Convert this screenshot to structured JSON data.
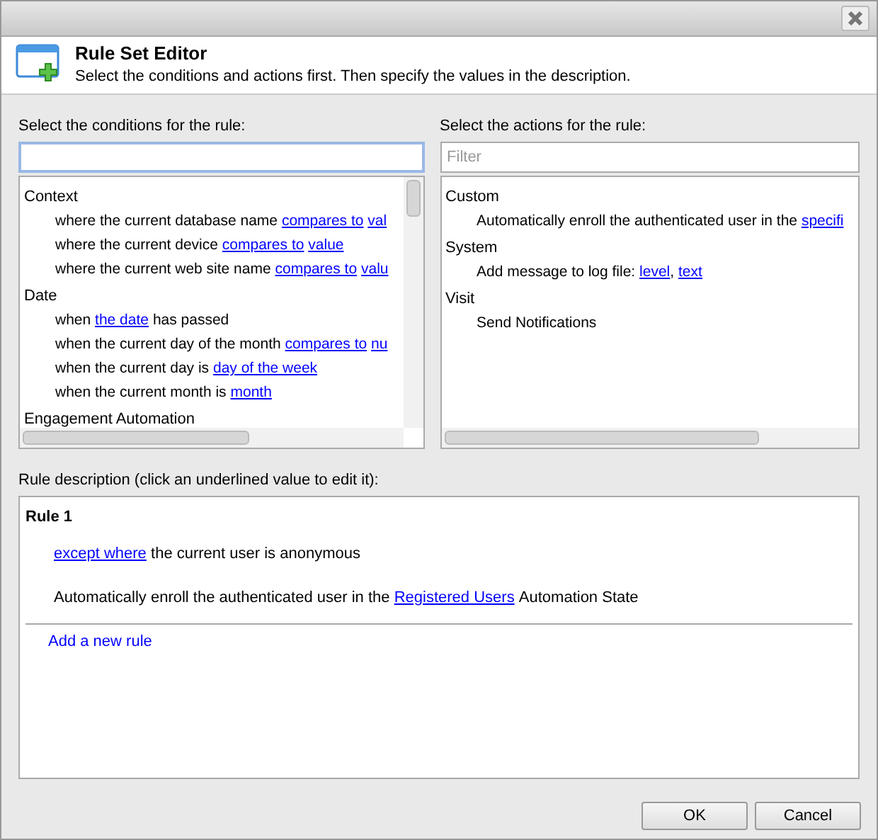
{
  "header": {
    "title": "Rule Set Editor",
    "subtitle": "Select the conditions and actions first. Then specify the values in the description."
  },
  "conditions": {
    "label": "Select the conditions for the rule:",
    "focused": true,
    "groups": [
      {
        "name": "Context",
        "items": [
          [
            {
              "kind": "plain",
              "text": "where the current database name"
            },
            {
              "kind": "link",
              "text": "compares to"
            },
            {
              "kind": "link",
              "text": "val"
            }
          ],
          [
            {
              "kind": "plain",
              "text": "where the current device"
            },
            {
              "kind": "link",
              "text": "compares to"
            },
            {
              "kind": "link",
              "text": "value"
            }
          ],
          [
            {
              "kind": "plain",
              "text": "where the current web site name"
            },
            {
              "kind": "link",
              "text": "compares to"
            },
            {
              "kind": "link",
              "text": "valu"
            }
          ]
        ]
      },
      {
        "name": "Date",
        "items": [
          [
            {
              "kind": "plain",
              "text": "when"
            },
            {
              "kind": "link",
              "text": "the date"
            },
            {
              "kind": "plain",
              "text": "has passed"
            }
          ],
          [
            {
              "kind": "plain",
              "text": "when the current day of the month"
            },
            {
              "kind": "link",
              "text": "compares to"
            },
            {
              "kind": "link",
              "text": "nu"
            }
          ],
          [
            {
              "kind": "plain",
              "text": "when the current day is"
            },
            {
              "kind": "link",
              "text": "day of the week"
            }
          ],
          [
            {
              "kind": "plain",
              "text": "when the current month is"
            },
            {
              "kind": "link",
              "text": "month"
            }
          ]
        ]
      },
      {
        "name": "Engagement Automation"
      }
    ]
  },
  "actions": {
    "label": "Select the actions for the rule:",
    "placeholder": "Filter",
    "groups": [
      {
        "name": "Custom",
        "items": [
          [
            {
              "kind": "plain",
              "text": "Automatically enroll the authenticated user in the"
            },
            {
              "kind": "link",
              "text": "specifi"
            }
          ]
        ]
      },
      {
        "name": "System",
        "items": [
          [
            {
              "kind": "plain",
              "text": "Add message to log file:"
            },
            {
              "kind": "link",
              "text": "level"
            },
            {
              "kind": "glued",
              "text": ","
            },
            {
              "kind": "link",
              "text": "text"
            }
          ]
        ]
      },
      {
        "name": "Visit",
        "items": [
          [
            {
              "kind": "plain",
              "text": "Send Notifications"
            }
          ]
        ]
      }
    ]
  },
  "description": {
    "label": "Rule description (click an underlined value to edit it):",
    "rules": [
      {
        "title": "Rule 1",
        "lines": [
          [
            {
              "kind": "link",
              "text": "except where"
            },
            {
              "kind": "plain",
              "text": "the current user is anonymous"
            }
          ],
          [
            {
              "kind": "plain",
              "text": "Automatically enroll the authenticated user in the"
            },
            {
              "kind": "link",
              "text": "Registered Users"
            },
            {
              "kind": "plain",
              "text": "Automation State"
            }
          ]
        ]
      }
    ],
    "add_link": "Add a new rule"
  },
  "buttons": [
    {
      "label": "OK"
    },
    {
      "label": "Cancel"
    }
  ]
}
